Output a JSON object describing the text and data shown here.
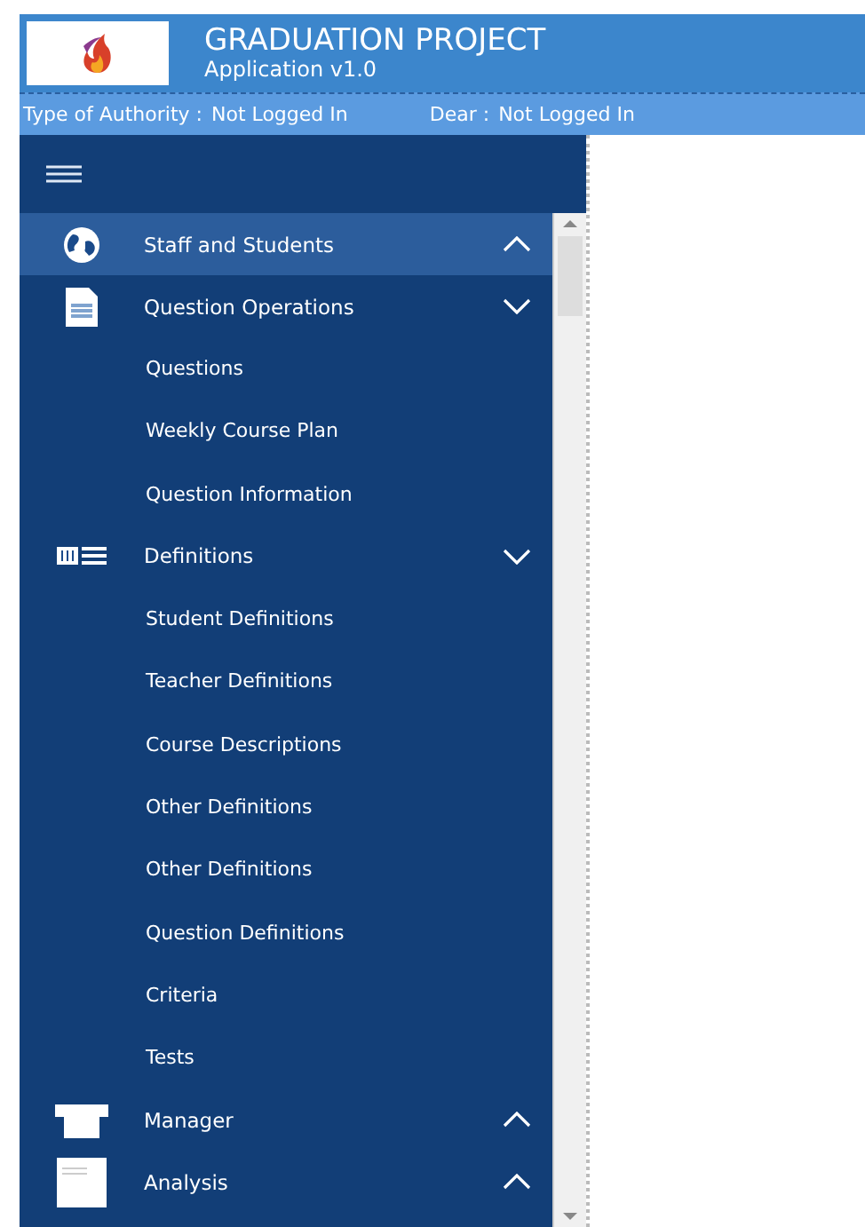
{
  "header": {
    "title": "GRADUATION PROJECT",
    "subtitle": "Application v1.0"
  },
  "status_bar": {
    "authority_label": "Type of Authority :",
    "authority_value": "Not Logged In",
    "dear_label": "Dear :",
    "dear_value": "Not Logged In"
  },
  "sidebar": {
    "groups": [
      {
        "label": "Staff and Students",
        "selected": true,
        "expanded": false
      },
      {
        "label": "Question Operations",
        "selected": false,
        "expanded": true,
        "children": [
          {
            "label": "Questions"
          },
          {
            "label": "Weekly Course Plan"
          },
          {
            "label": "Question Information"
          }
        ]
      },
      {
        "label": "Definitions",
        "selected": false,
        "expanded": true,
        "children": [
          {
            "label": "Student Definitions"
          },
          {
            "label": "Teacher Definitions"
          },
          {
            "label": "Course Descriptions"
          },
          {
            "label": "Other Definitions"
          },
          {
            "label": "Other Definitions"
          },
          {
            "label": "Question Definitions"
          },
          {
            "label": "Criteria"
          },
          {
            "label": "Tests"
          }
        ]
      },
      {
        "label": "Manager",
        "selected": false,
        "expanded": false
      },
      {
        "label": "Analysis",
        "selected": false,
        "expanded": false
      }
    ]
  }
}
